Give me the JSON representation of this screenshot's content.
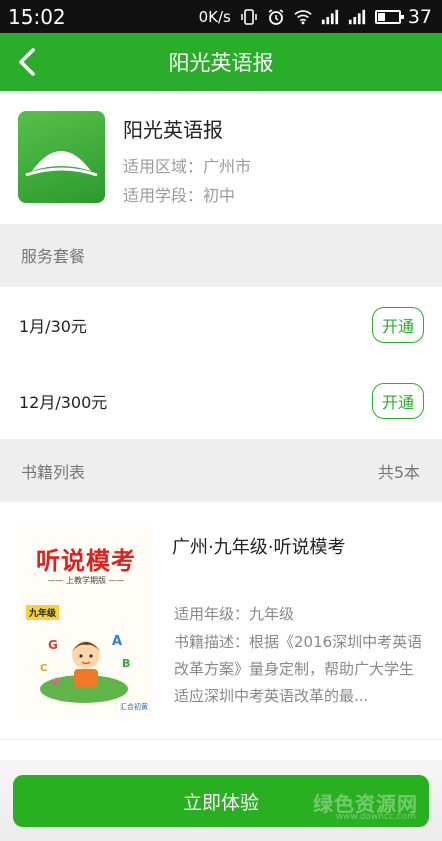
{
  "status_bar": {
    "time": "15:02",
    "network_speed": "0K/s",
    "battery": "37",
    "battery_level": 0.37
  },
  "app_bar": {
    "title": "阳光英语报",
    "back_icon": "chevron-left-icon"
  },
  "app_info": {
    "name": "阳光英语报",
    "region": "适用区域：广州市",
    "stage": "适用学段：初中",
    "logo_icon": "sunrise-hill-icon"
  },
  "packages": {
    "header": "服务套餐",
    "items": [
      {
        "label": "1月/30元",
        "button": "开通"
      },
      {
        "label": "12月/300元",
        "button": "开通"
      }
    ]
  },
  "books": {
    "header": "书籍列表",
    "count": "共5本",
    "items": [
      {
        "title": "广州·九年级·听说模考",
        "grade": "适用年级：九年级",
        "description": "书籍描述：根据《2016深圳中考英语改革方案》量身定制，帮助广大学生适应深圳中考英语改革的最...",
        "cover": {
          "title": "听说模考",
          "subtitle": "—— 上教学期版 ——",
          "grade_tag": "九年级",
          "brand": "汇合初黄"
        }
      }
    ]
  },
  "cta": {
    "label": "立即体验"
  },
  "watermark": {
    "text": "绿色资源网",
    "sub": "www.downcc.com"
  },
  "colors": {
    "primary_green": "#2aad2a",
    "cta_green": "#29b020",
    "status_bar": "#111111",
    "section_bg": "#eeeeee"
  }
}
